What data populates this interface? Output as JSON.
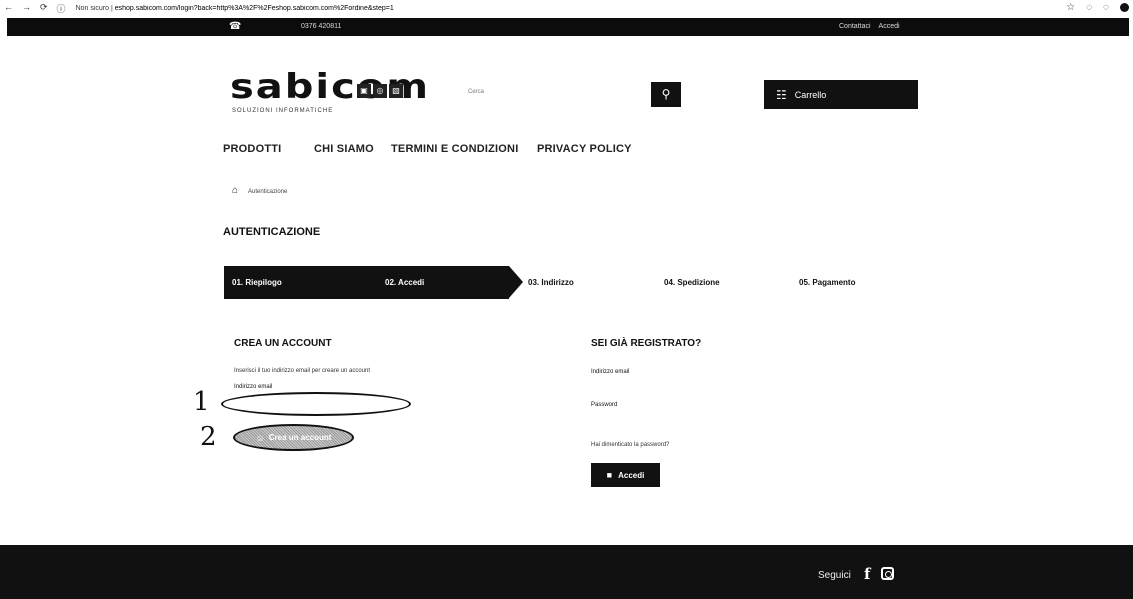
{
  "browser": {
    "back_glyph": "←",
    "forward_glyph": "→",
    "reload_glyph": "⟳",
    "info_glyph": "ⓘ",
    "star_glyph": "☆",
    "extension_glyphs": [
      "◌",
      "◌"
    ],
    "url_prefix": "Non sicuro | ",
    "url": "eshop.sabicom.com/login?back=http%3A%2F%2Feshop.sabicom.com%2Fordine&step=1"
  },
  "topbar": {
    "phone_glyph": "☎",
    "phone": "0376 420811",
    "links": [
      "Contattaci",
      "Accedi"
    ]
  },
  "header": {
    "logo_text": "sabicom",
    "logo_icon_glyphs": [
      "▣",
      "◎",
      "▧"
    ],
    "tagline": "SOLUZIONI INFORMATICHE",
    "search_placeholder": "Cerca",
    "search_glyph": "⚲",
    "cart_glyph": "☷",
    "cart_label": "Carrello"
  },
  "menu": [
    "PRODOTTI",
    "CHI SIAMO",
    "TERMINI E CONDIZIONI",
    "PRIVACY POLICY"
  ],
  "breadcrumb": {
    "home_glyph": "⌂",
    "current": "Autenticazione"
  },
  "page_title": "AUTENTICAZIONE",
  "steps": [
    "01. Riepilogo",
    "02. Accedi",
    "03. Indirizzo",
    "04. Spedizione",
    "05. Pagamento"
  ],
  "create_account": {
    "heading": "CREA UN ACCOUNT",
    "description": "Inserisci il tuo indirizzo email per creare un account",
    "email_label": "Indirizzo email",
    "button_icon_glyph": "☺",
    "button_label": "Crea un account",
    "annotation_1": "1",
    "annotation_2": "2"
  },
  "login": {
    "heading": "SEI GIÀ REGISTRATO?",
    "email_label": "Indirizzo email",
    "password_label": "Password",
    "forgot_label": "Hai dimenticato la password?",
    "button_icon_glyph": "■",
    "button_label": "Accedi"
  },
  "footer": {
    "follow_label": "Seguici",
    "facebook_glyph": "f"
  }
}
